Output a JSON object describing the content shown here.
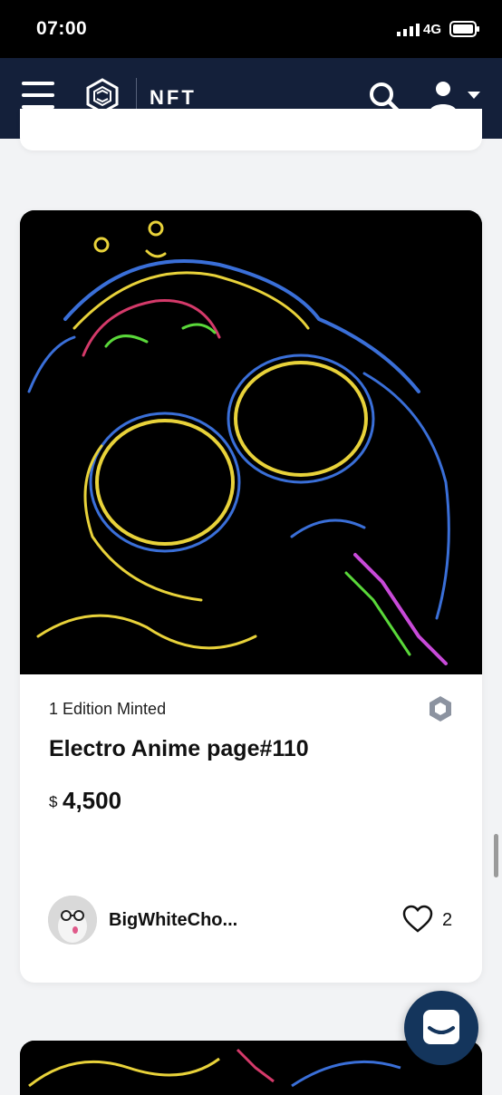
{
  "status_bar": {
    "time": "07:00",
    "network": "4G",
    "icons": [
      "signal-icon",
      "battery-icon"
    ]
  },
  "navbar": {
    "brand_label": "NFT",
    "icons": [
      "menu-icon",
      "crypto-logo-icon",
      "search-icon",
      "user-icon",
      "caret-down-icon"
    ]
  },
  "listing": {
    "edition": "1 Edition Minted",
    "title": "Electro Anime page#110",
    "price_currency": "$",
    "price_value": "4,500",
    "creator": "BigWhiteCho...",
    "likes": "2",
    "icons": [
      "hexagon-icon",
      "heart-icon"
    ]
  },
  "colors": {
    "navbar": "#14203a",
    "chat_button": "#14355c",
    "page_background": "#f2f3f5"
  }
}
